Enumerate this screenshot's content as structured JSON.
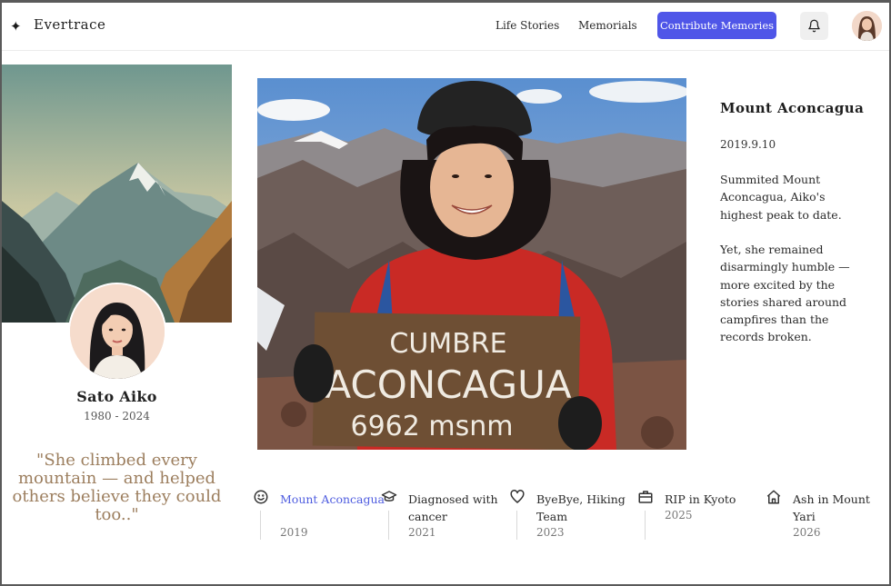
{
  "header": {
    "brand": "Evertrace",
    "nav": [
      "Life Stories",
      "Memorials"
    ],
    "cta": "Contribute Memories",
    "icons": [
      "sparkle-icon",
      "bell-icon"
    ]
  },
  "profile": {
    "name": "Sato Aiko",
    "dates": "1980 - 2024",
    "quote": "\"She climbed every mountain — and helped others believe they could too..\""
  },
  "photo": {
    "sign_line1": "CUMBRE",
    "sign_line2": "ACONCAGUA",
    "sign_line3": "6962 msnm"
  },
  "detail": {
    "title": "Mount Aconcagua",
    "date": "2019.9.10",
    "paragraph1": "Summited Mount Aconcagua, Aiko's highest peak to date.",
    "paragraph2": "Yet, she remained disarmingly humble — more excited by the stories shared around campfires than the records broken."
  },
  "timeline": [
    {
      "label": "Mount Aconcagua",
      "year": "2019",
      "icon": "smiley-icon",
      "active": true
    },
    {
      "label": "Diagnosed with cancer",
      "year": "2021",
      "icon": "graduation-cap-icon",
      "active": false
    },
    {
      "label": "ByeBye, Hiking Team",
      "year": "2023",
      "icon": "heart-icon",
      "active": false
    },
    {
      "label": "RIP in Kyoto",
      "year": "2025",
      "icon": "briefcase-icon",
      "active": false
    },
    {
      "label": "Ash in Mount Yari",
      "year": "2026",
      "icon": "home-icon",
      "active": false
    }
  ],
  "colors": {
    "accent": "#4f56e8",
    "quote": "#9c7e5e",
    "active_timeline": "#4f5de0"
  }
}
